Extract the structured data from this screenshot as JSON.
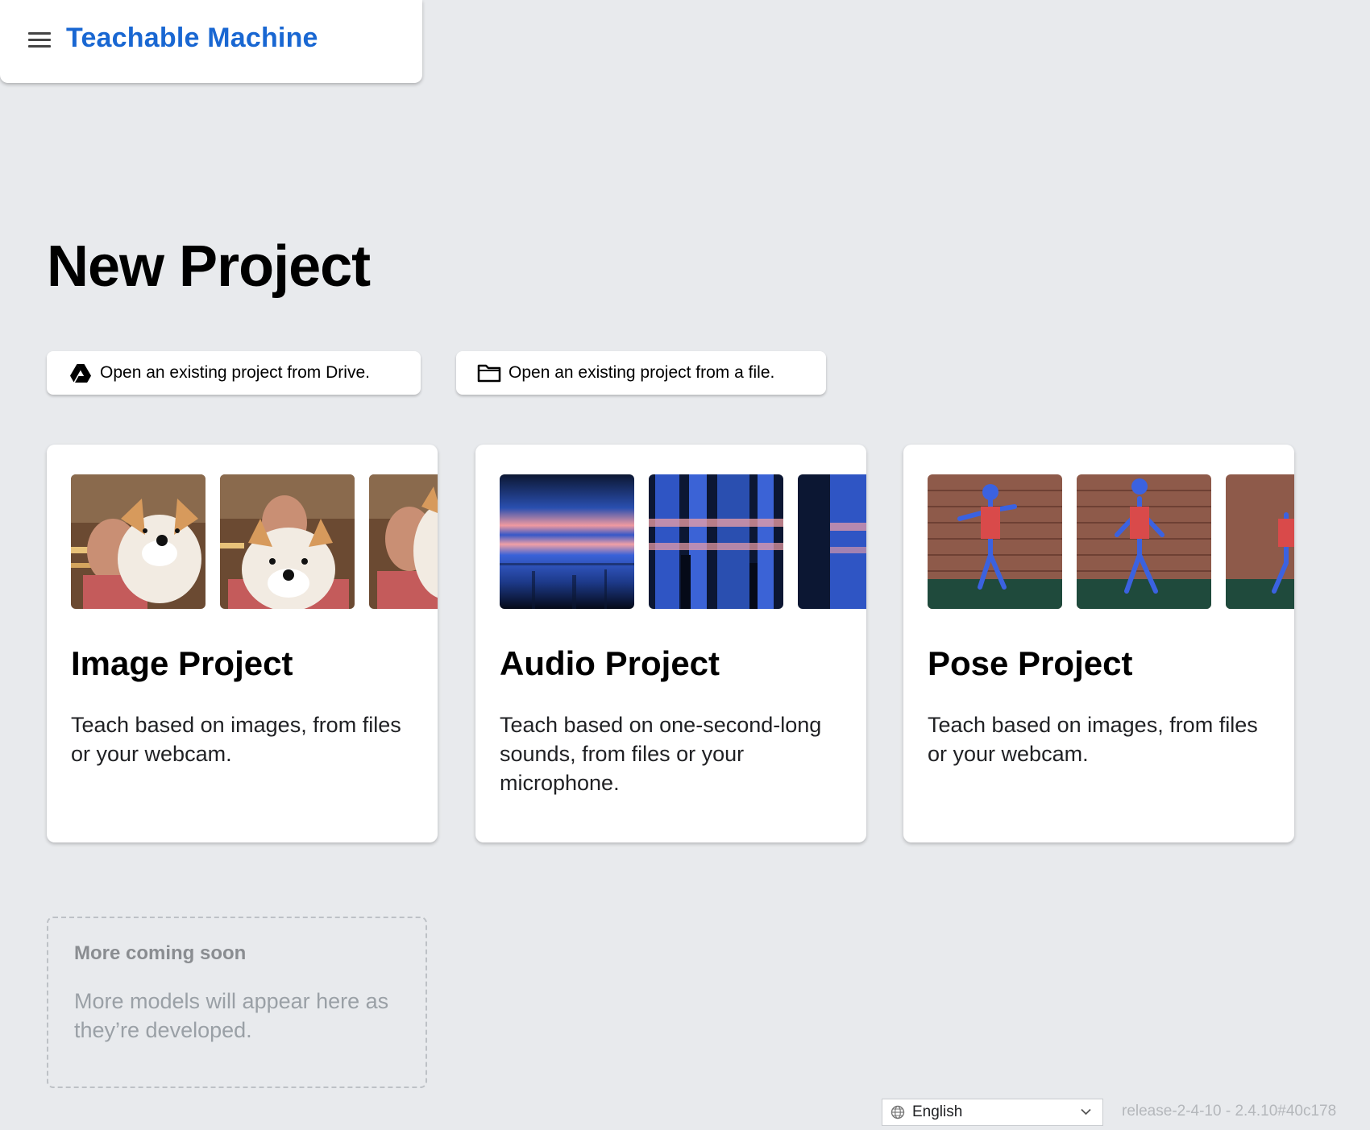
{
  "header": {
    "app_title": "Teachable Machine",
    "menu_icon": "hamburger-menu-icon"
  },
  "main": {
    "title": "New Project",
    "open_buttons": [
      {
        "label": "Open an existing project from Drive.",
        "icon": "google-drive-icon"
      },
      {
        "label": "Open an existing project from a file.",
        "icon": "folder-icon"
      }
    ],
    "cards": [
      {
        "title": "Image Project",
        "description": "Teach based on images, from files or your webcam."
      },
      {
        "title": "Audio Project",
        "description": "Teach based on one-second-long sounds, from files or your microphone."
      },
      {
        "title": "Pose Project",
        "description": "Teach based on images, from files or your webcam."
      }
    ],
    "coming_soon": {
      "title": "More coming soon",
      "description": "More models will appear here as they’re developed."
    }
  },
  "footer": {
    "language": "English",
    "version": "release-2-4-10 - 2.4.10#40c178"
  },
  "colors": {
    "brand": "#1967d2",
    "background": "#e8eaed"
  }
}
